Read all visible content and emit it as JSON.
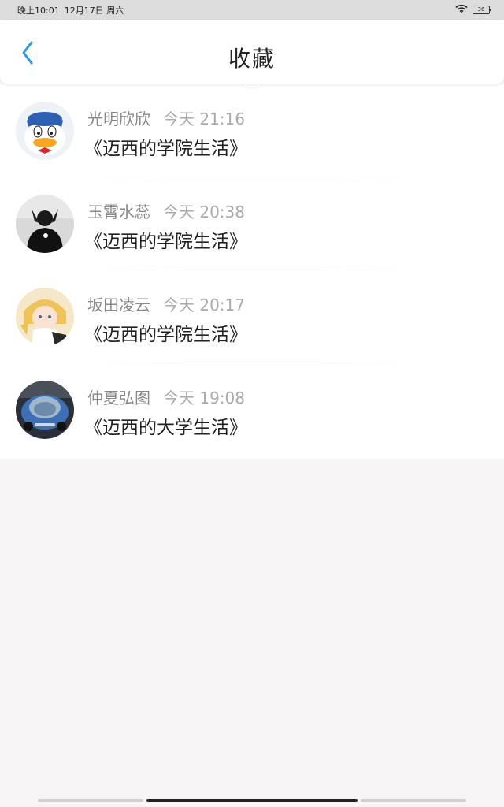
{
  "status_bar": {
    "time": "晚上10:01",
    "date": "12月17日 周六",
    "battery": "36",
    "icons": [
      "wifi-icon",
      "battery-icon"
    ]
  },
  "header": {
    "title": "收藏",
    "back_icon": "chevron-left-icon",
    "accent_color": "#2a9bea"
  },
  "favorites": [
    {
      "user": "光明欣欣",
      "time": "今天 21:16",
      "title": "《迈西的学院生活》",
      "avatar": "donald-duck-avatar"
    },
    {
      "user": "玉霄水蕊",
      "time": "今天 20:38",
      "title": "《迈西的学院生活》",
      "avatar": "person-photo-avatar"
    },
    {
      "user": "坂田凌云",
      "time": "今天 20:17",
      "title": "《迈西的学院生活》",
      "avatar": "anime-girl-avatar"
    },
    {
      "user": "仲夏弘图",
      "time": "今天 19:08",
      "title": "《迈西的大学生活》",
      "avatar": "concept-car-avatar"
    }
  ]
}
